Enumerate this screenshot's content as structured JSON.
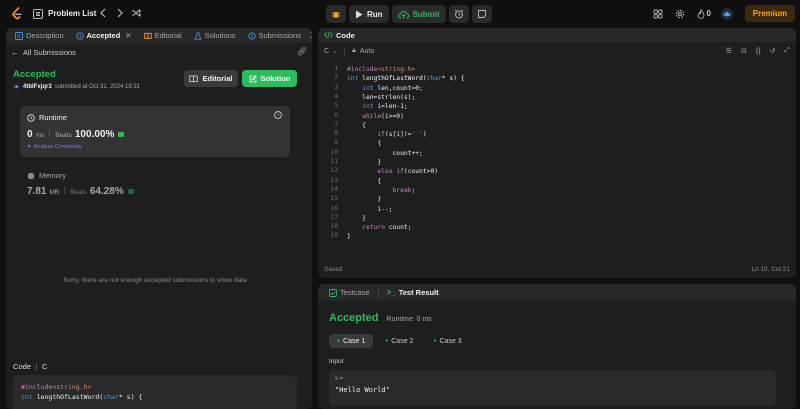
{
  "topbar": {
    "problem_list_label": "Problem List",
    "run_label": "Run",
    "submit_label": "Submit",
    "fire_count": "0",
    "premium_label": "Premium"
  },
  "left": {
    "tabs": [
      {
        "label": "Description"
      },
      {
        "label": "Accepted"
      },
      {
        "label": "Editorial"
      },
      {
        "label": "Solutions"
      },
      {
        "label": "Submissions"
      }
    ],
    "back_label": "All Submissions",
    "status": "Accepted",
    "username": "4tbIFxjqr3",
    "submitted_text": "submitted at Oct 31, 2024 18:31",
    "editorial_button": "Editorial",
    "solution_button": "Solution",
    "runtime": {
      "title": "Runtime",
      "value": "0",
      "unit": "ms",
      "beats_label": "Beats",
      "beats_value": "100.00%",
      "analyze_label": "Analyze Complexity"
    },
    "memory": {
      "title": "Memory",
      "value": "7.81",
      "unit": "MB",
      "beats_label": "Beats",
      "beats_value": "64.28%"
    },
    "not_enough_text": "Sorry, there are not enough accepted submissions to show data",
    "code_label": "Code",
    "code_lang": "C",
    "code_preview": [
      "#include<string.h>",
      "int lengthOfLastWord(char* s) {"
    ]
  },
  "editor": {
    "title": "Code",
    "language": "C",
    "auto_label": "Auto",
    "saved_label": "Saved",
    "cursor_pos": "Ln 10, Col 21",
    "lines": [
      "#include<string.h>",
      "int lengthOfLastWord(char* s) {",
      "    int len,count=0;",
      "    len=strlen(s);",
      "    int i=len-1;",
      "    while(i>=0)",
      "    {",
      "        if(s[i]!=' ')",
      "        {",
      "            count++;",
      "        }",
      "        else if(count>0)",
      "        {",
      "            break;",
      "        }",
      "        i--;",
      "    }",
      "    return count;",
      "}"
    ]
  },
  "result": {
    "testcase_tab": "Testcase",
    "result_tab": "Test Result",
    "status": "Accepted",
    "runtime_text": "Runtime: 0 ms",
    "cases": [
      "Case 1",
      "Case 2",
      "Case 3"
    ],
    "input_label": "Input",
    "var_name": "s =",
    "var_value": "\"Hello World\""
  },
  "colors": {
    "accent_green": "#2cbb5d",
    "premium_orange": "#ffa116",
    "link_purple": "#7b7bf5"
  }
}
